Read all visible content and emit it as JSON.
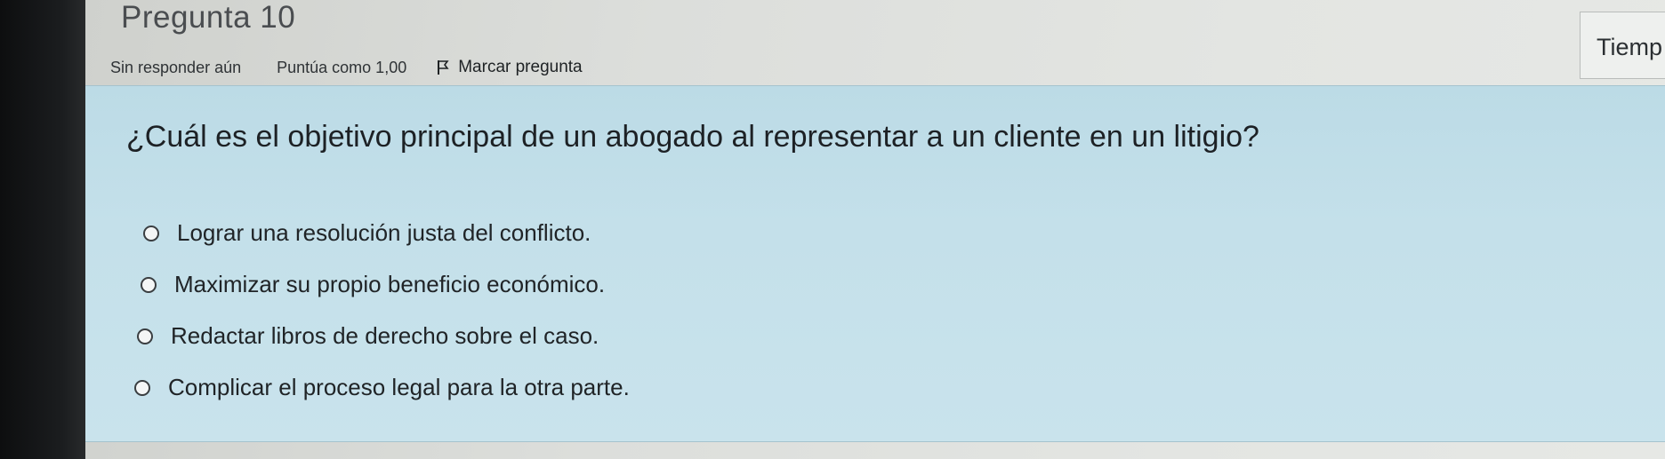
{
  "header": {
    "title": "Pregunta 10"
  },
  "meta": {
    "status": "Sin responder aún",
    "points": "Puntúa como 1,00",
    "flag_label": "Marcar pregunta"
  },
  "timer": {
    "label": "Tiemp"
  },
  "question": {
    "text": "¿Cuál es el objetivo principal de un abogado al representar a un cliente en un litigio?",
    "options": [
      {
        "label": "Lograr una resolución justa del conflicto."
      },
      {
        "label": "Maximizar su propio beneficio económico."
      },
      {
        "label": "Redactar libros de derecho sobre el caso."
      },
      {
        "label": "Complicar el proceso legal para la otra parte."
      }
    ]
  },
  "colors": {
    "question_bg": "#c4e0ea",
    "page_bg": "#dcdedb"
  }
}
